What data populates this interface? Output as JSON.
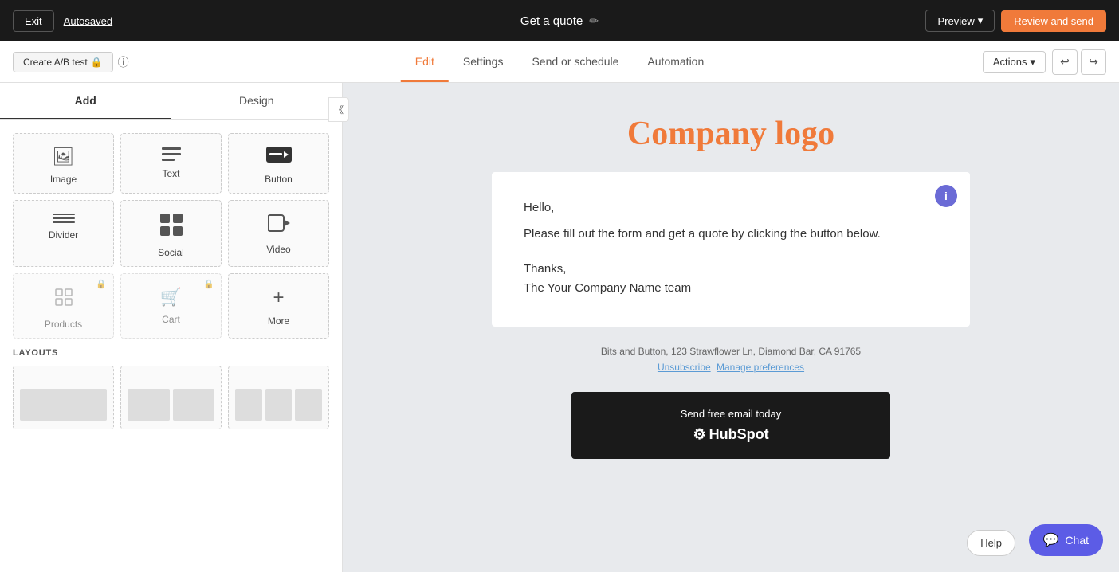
{
  "topbar": {
    "exit_label": "Exit",
    "autosaved_label": "Autosaved",
    "page_title": "Get a quote",
    "edit_icon": "✏",
    "preview_label": "Preview",
    "preview_chevron": "▾",
    "review_label": "Review and send"
  },
  "navbar": {
    "ab_test_label": "Create A/B test",
    "info_icon": "?",
    "tabs": [
      {
        "label": "Edit",
        "active": true
      },
      {
        "label": "Settings",
        "active": false
      },
      {
        "label": "Send or schedule",
        "active": false
      },
      {
        "label": "Automation",
        "active": false
      }
    ],
    "actions_label": "Actions",
    "actions_chevron": "▾",
    "undo_icon": "↩",
    "redo_icon": "↪"
  },
  "sidebar": {
    "collapse_icon": "《",
    "tabs": [
      {
        "label": "Add",
        "active": true
      },
      {
        "label": "Design",
        "active": false
      }
    ],
    "elements": [
      {
        "label": "Image",
        "icon": "🖼",
        "locked": false,
        "name": "image-element"
      },
      {
        "label": "Text",
        "icon": "≡",
        "locked": false,
        "name": "text-element"
      },
      {
        "label": "Button",
        "icon": "▬",
        "locked": false,
        "name": "button-element"
      },
      {
        "label": "Divider",
        "icon": "━",
        "locked": false,
        "name": "divider-element"
      },
      {
        "label": "Social",
        "icon": "⊞",
        "locked": false,
        "name": "social-element"
      },
      {
        "label": "Video",
        "icon": "▶",
        "locked": false,
        "name": "video-element"
      },
      {
        "label": "Products",
        "icon": "◻",
        "locked": true,
        "name": "products-element"
      },
      {
        "label": "Cart",
        "icon": "🛒",
        "locked": true,
        "name": "cart-element"
      },
      {
        "label": "More",
        "icon": "+",
        "locked": false,
        "name": "more-element"
      }
    ],
    "layouts_title": "LAYOUTS",
    "layouts": [
      {
        "columns": 1,
        "name": "layout-single"
      },
      {
        "columns": 2,
        "name": "layout-two-col"
      },
      {
        "columns": 3,
        "name": "layout-three-col"
      }
    ]
  },
  "canvas": {
    "company_logo": "Company logo",
    "info_badge": "i",
    "email": {
      "greeting": "Hello,",
      "body": "Please fill out the form and get a quote by clicking the button below.",
      "sign_off": "Thanks,",
      "team": "The Your Company Name team"
    },
    "footer": {
      "address": "Bits and Button, 123 Strawflower Ln, Diamond Bar, CA 91765",
      "unsubscribe_label": "Unsubscribe",
      "manage_label": "Manage preferences"
    },
    "hubspot_banner": {
      "promo": "Send free email today",
      "logo": "HubSpot"
    }
  },
  "chat": {
    "icon": "💬",
    "label": "Chat"
  },
  "help": {
    "label": "Help"
  }
}
